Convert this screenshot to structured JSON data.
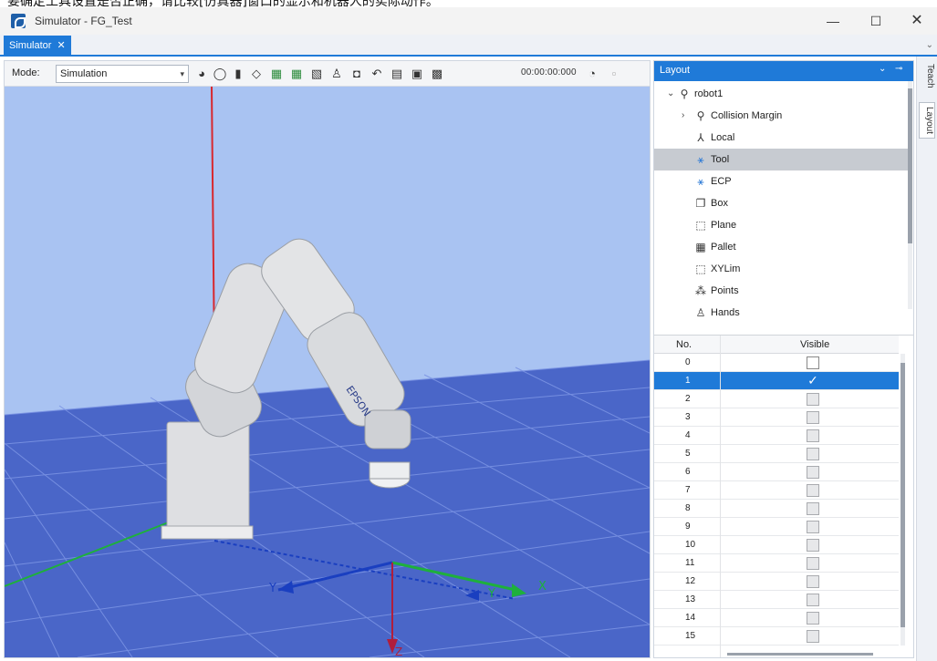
{
  "top_text": "要确定工具设置是否正确，请比较[仿真器]窗口的显示和机器人的实际动作。",
  "window": {
    "title": "Simulator - FG_Test",
    "minimize": "—",
    "maximize": "☐",
    "close": "✕"
  },
  "tabs": [
    {
      "label": "Simulator",
      "close": "✕"
    }
  ],
  "tabstrip_chevron": "⌄",
  "toolbar": {
    "mode_label": "Mode:",
    "mode_value": "Simulation",
    "timer": "00:00:00:000"
  },
  "viewport": {
    "axis_labels": {
      "x": "X",
      "y_left": "Y",
      "y_right": "Y",
      "z": "Z"
    },
    "robot_brand": "EPSON",
    "colors": {
      "sky": "#a9c3f2",
      "floor": "#4a66c8",
      "grid": "#6f8ae0"
    }
  },
  "panel": {
    "title": "Layout",
    "pin": "⊸",
    "dropdown": "⌄",
    "tree": [
      {
        "label": "robot1",
        "icon": "robot-icon",
        "expanded": true
      },
      {
        "label": "Collision Margin",
        "icon": "robot-icon",
        "expandable": true
      },
      {
        "label": "Local",
        "icon": "local-axes-icon"
      },
      {
        "label": "Tool",
        "icon": "tool-icon",
        "selected": true
      },
      {
        "label": "ECP",
        "icon": "ecp-icon"
      },
      {
        "label": "Box",
        "icon": "box-icon"
      },
      {
        "label": "Plane",
        "icon": "plane-icon"
      },
      {
        "label": "Pallet",
        "icon": "pallet-icon"
      },
      {
        "label": "XYLim",
        "icon": "xylim-icon"
      },
      {
        "label": "Points",
        "icon": "points-icon"
      },
      {
        "label": "Hands",
        "icon": "hands-icon"
      }
    ],
    "grid": {
      "headers": {
        "no": "No.",
        "visible": "Visible"
      },
      "rows": [
        {
          "no": "0",
          "visible": false,
          "enabled": true
        },
        {
          "no": "1",
          "visible": true,
          "enabled": true,
          "selected": true
        },
        {
          "no": "2",
          "visible": false,
          "enabled": false
        },
        {
          "no": "3",
          "visible": false,
          "enabled": false
        },
        {
          "no": "4",
          "visible": false,
          "enabled": false
        },
        {
          "no": "5",
          "visible": false,
          "enabled": false
        },
        {
          "no": "6",
          "visible": false,
          "enabled": false
        },
        {
          "no": "7",
          "visible": false,
          "enabled": false
        },
        {
          "no": "8",
          "visible": false,
          "enabled": false
        },
        {
          "no": "9",
          "visible": false,
          "enabled": false
        },
        {
          "no": "10",
          "visible": false,
          "enabled": false
        },
        {
          "no": "11",
          "visible": false,
          "enabled": false
        },
        {
          "no": "12",
          "visible": false,
          "enabled": false
        },
        {
          "no": "13",
          "visible": false,
          "enabled": false
        },
        {
          "no": "14",
          "visible": false,
          "enabled": false
        },
        {
          "no": "15",
          "visible": false,
          "enabled": false
        }
      ]
    }
  },
  "side_tabs": {
    "teach": "Teach",
    "layout": "Layout"
  },
  "check_mark": "✓"
}
